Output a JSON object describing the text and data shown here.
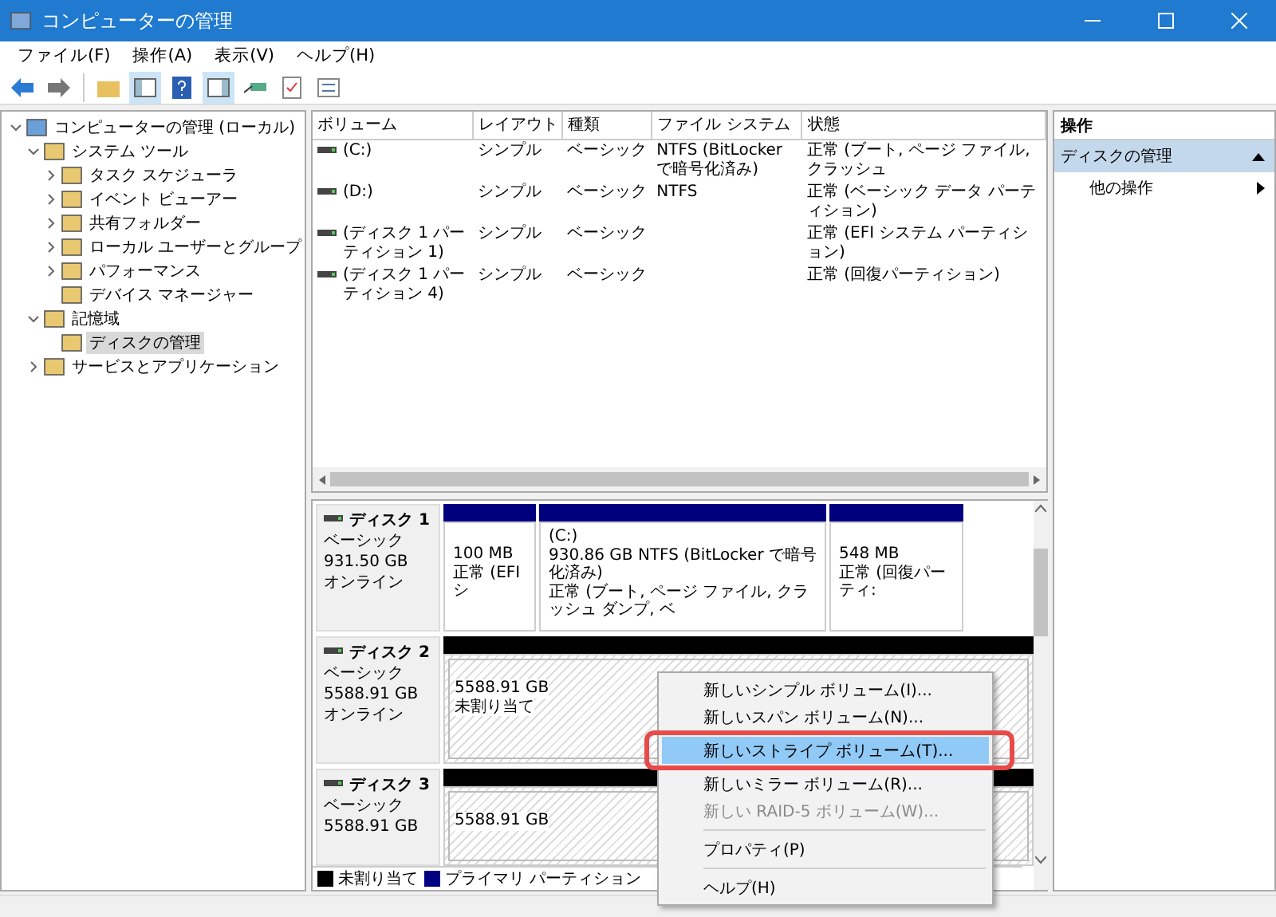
{
  "window": {
    "title": "コンピューターの管理"
  },
  "menu": [
    "ファイル(F)",
    "操作(A)",
    "表示(V)",
    "ヘルプ(H)"
  ],
  "tree": [
    {
      "label": "コンピューターの管理 (ローカル)",
      "expanded": true,
      "selected": false,
      "children": [
        {
          "label": "システム ツール",
          "expanded": true,
          "selected": false,
          "children": [
            {
              "label": "タスク スケジューラ",
              "expanded": false,
              "selected": false
            },
            {
              "label": "イベント ビューアー",
              "expanded": false,
              "selected": false
            },
            {
              "label": "共有フォルダー",
              "expanded": false,
              "selected": false
            },
            {
              "label": "ローカル ユーザーとグループ",
              "expanded": false,
              "selected": false
            },
            {
              "label": "パフォーマンス",
              "expanded": false,
              "selected": false
            },
            {
              "label": "デバイス マネージャー",
              "selected": false
            }
          ]
        },
        {
          "label": "記憶域",
          "expanded": true,
          "selected": false,
          "children": [
            {
              "label": "ディスクの管理",
              "selected": true
            }
          ]
        },
        {
          "label": "サービスとアプリケーション",
          "expanded": false,
          "selected": false
        }
      ]
    }
  ],
  "volumes": {
    "columns": [
      "ボリューム",
      "レイアウト",
      "種類",
      "ファイル システム",
      "状態"
    ],
    "rows": [
      [
        "(C:)",
        "シンプル",
        "ベーシック",
        "NTFS (BitLocker で暗号化済み)",
        "正常 (ブート, ページ ファイル, クラッシュ"
      ],
      [
        "(D:)",
        "シンプル",
        "ベーシック",
        "NTFS",
        "正常 (ベーシック データ パーティション)"
      ],
      [
        "(ディスク 1 パーティション 1)",
        "シンプル",
        "ベーシック",
        "",
        "正常 (EFI システム パーティション)"
      ],
      [
        "(ディスク 1 パーティション 4)",
        "シンプル",
        "ベーシック",
        "",
        "正常 (回復パーティション)"
      ]
    ]
  },
  "disks": [
    {
      "name": "ディスク 1",
      "type": "ベーシック",
      "size": "931.50 GB",
      "status": "オンライン",
      "partitions": [
        {
          "kind": "primary",
          "size": "100 MB",
          "status": "正常 (EFI シ"
        },
        {
          "kind": "primary",
          "volume": "(C:)",
          "size": "930.86 GB NTFS (BitLocker で暗号化済み)",
          "status": "正常 (ブート, ページ ファイル, クラッシュ ダンプ, ベ"
        },
        {
          "kind": "primary",
          "size": "548 MB",
          "status": "正常 (回復パーティ:"
        }
      ]
    },
    {
      "name": "ディスク 2",
      "type": "ベーシック",
      "size": "5588.91 GB",
      "status": "オンライン",
      "partitions": [
        {
          "kind": "unallocated",
          "size": "5588.91 GB",
          "status": "未割り当て"
        }
      ]
    },
    {
      "name": "ディスク 3",
      "type": "ベーシック",
      "size": "5588.91 GB",
      "partitions": [
        {
          "kind": "unallocated",
          "size": "5588.91 GB"
        }
      ]
    }
  ],
  "legend": [
    {
      "label": "未割り当て",
      "color": "#000000"
    },
    {
      "label": "プライマリ パーティション",
      "color": "#000080"
    }
  ],
  "actions": {
    "heading": "操作",
    "section": "ディスクの管理",
    "items": [
      "他の操作"
    ]
  },
  "context_menu": [
    {
      "kind": "item",
      "label": "新しいシンプル ボリューム(I)...",
      "disabled": false,
      "selected": false
    },
    {
      "kind": "item",
      "label": "新しいスパン ボリューム(N)...",
      "disabled": false,
      "selected": false
    },
    {
      "kind": "item",
      "label": "新しいストライプ ボリューム(T)...",
      "disabled": false,
      "selected": true
    },
    {
      "kind": "item",
      "label": "新しいミラー ボリューム(R)...",
      "disabled": false,
      "selected": false
    },
    {
      "kind": "item",
      "label": "新しい RAID-5 ボリューム(W)...",
      "disabled": true,
      "selected": false
    },
    {
      "kind": "separator"
    },
    {
      "kind": "item",
      "label": "プロパティ(P)",
      "disabled": false,
      "selected": false
    },
    {
      "kind": "separator"
    },
    {
      "kind": "item",
      "label": "ヘルプ(H)",
      "disabled": false,
      "selected": false
    }
  ]
}
